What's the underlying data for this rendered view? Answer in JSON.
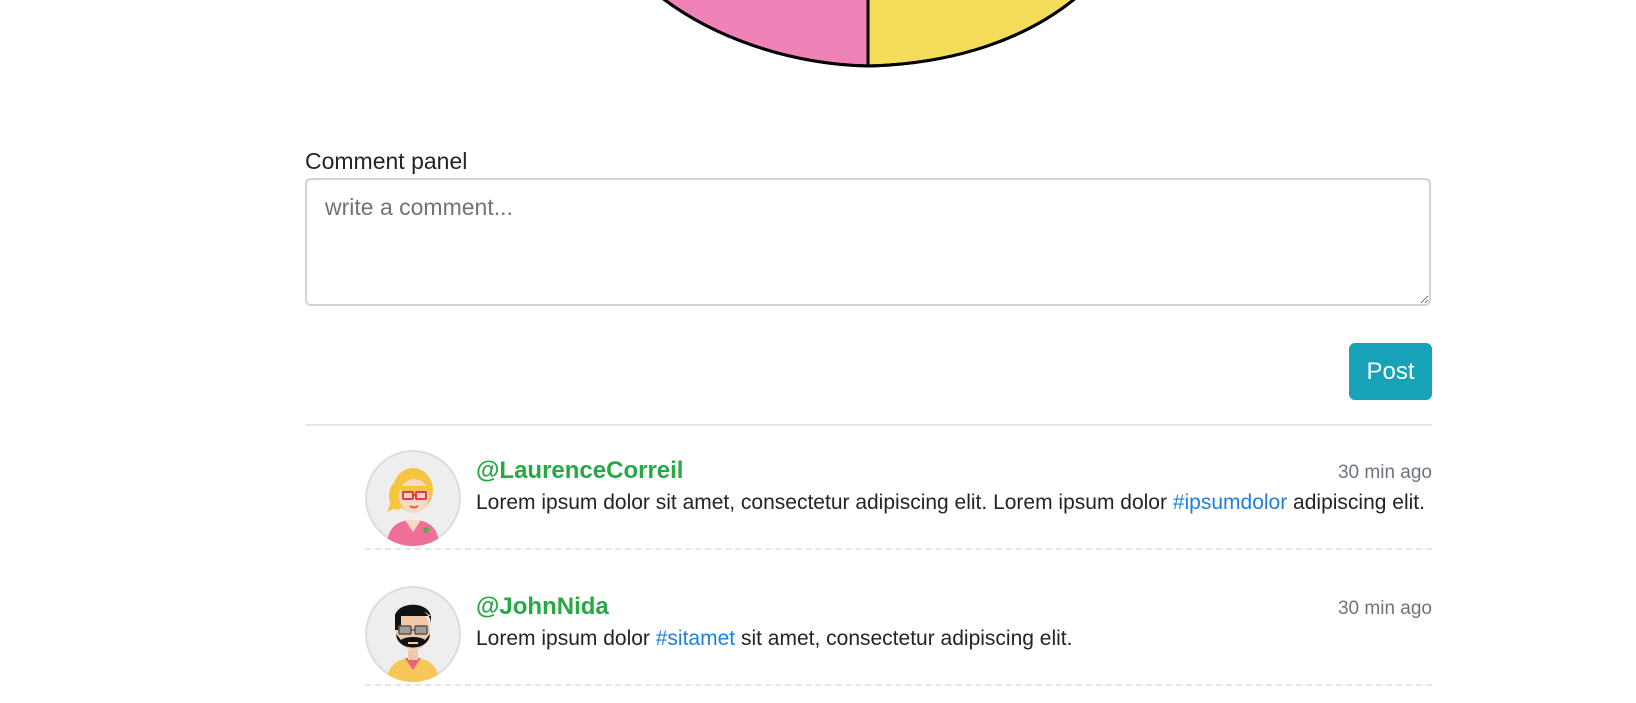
{
  "chart_data": {
    "type": "pie",
    "title": "",
    "slices": [
      {
        "label": "",
        "color": "#ef83b8"
      },
      {
        "label": "",
        "color": "#f3dc59"
      }
    ]
  },
  "comment_panel": {
    "label": "Comment panel",
    "placeholder": "write a comment...",
    "post_label": "Post"
  },
  "comments": [
    {
      "username": "@LaurenceCorreil",
      "time": "30 min ago",
      "text_before": "Lorem ipsum dolor sit amet, consectetur adipiscing elit. Lorem ipsum dolor ",
      "hashtag": "#ipsumdolor",
      "text_after": " adipiscing elit.",
      "avatar_icon": "woman-avatar-icon"
    },
    {
      "username": "@JohnNida",
      "time": "30 min ago",
      "text_before": "Lorem ipsum dolor ",
      "hashtag": "#sitamet",
      "text_after": " sit amet, consectetur adipiscing elit.",
      "avatar_icon": "bearded-man-avatar-icon"
    }
  ],
  "colors": {
    "username": "#28a745",
    "hashtag": "#1e7fe0",
    "post_button": "#17a2b8",
    "pie_pink": "#ef83b8",
    "pie_yellow": "#f3dc59"
  }
}
